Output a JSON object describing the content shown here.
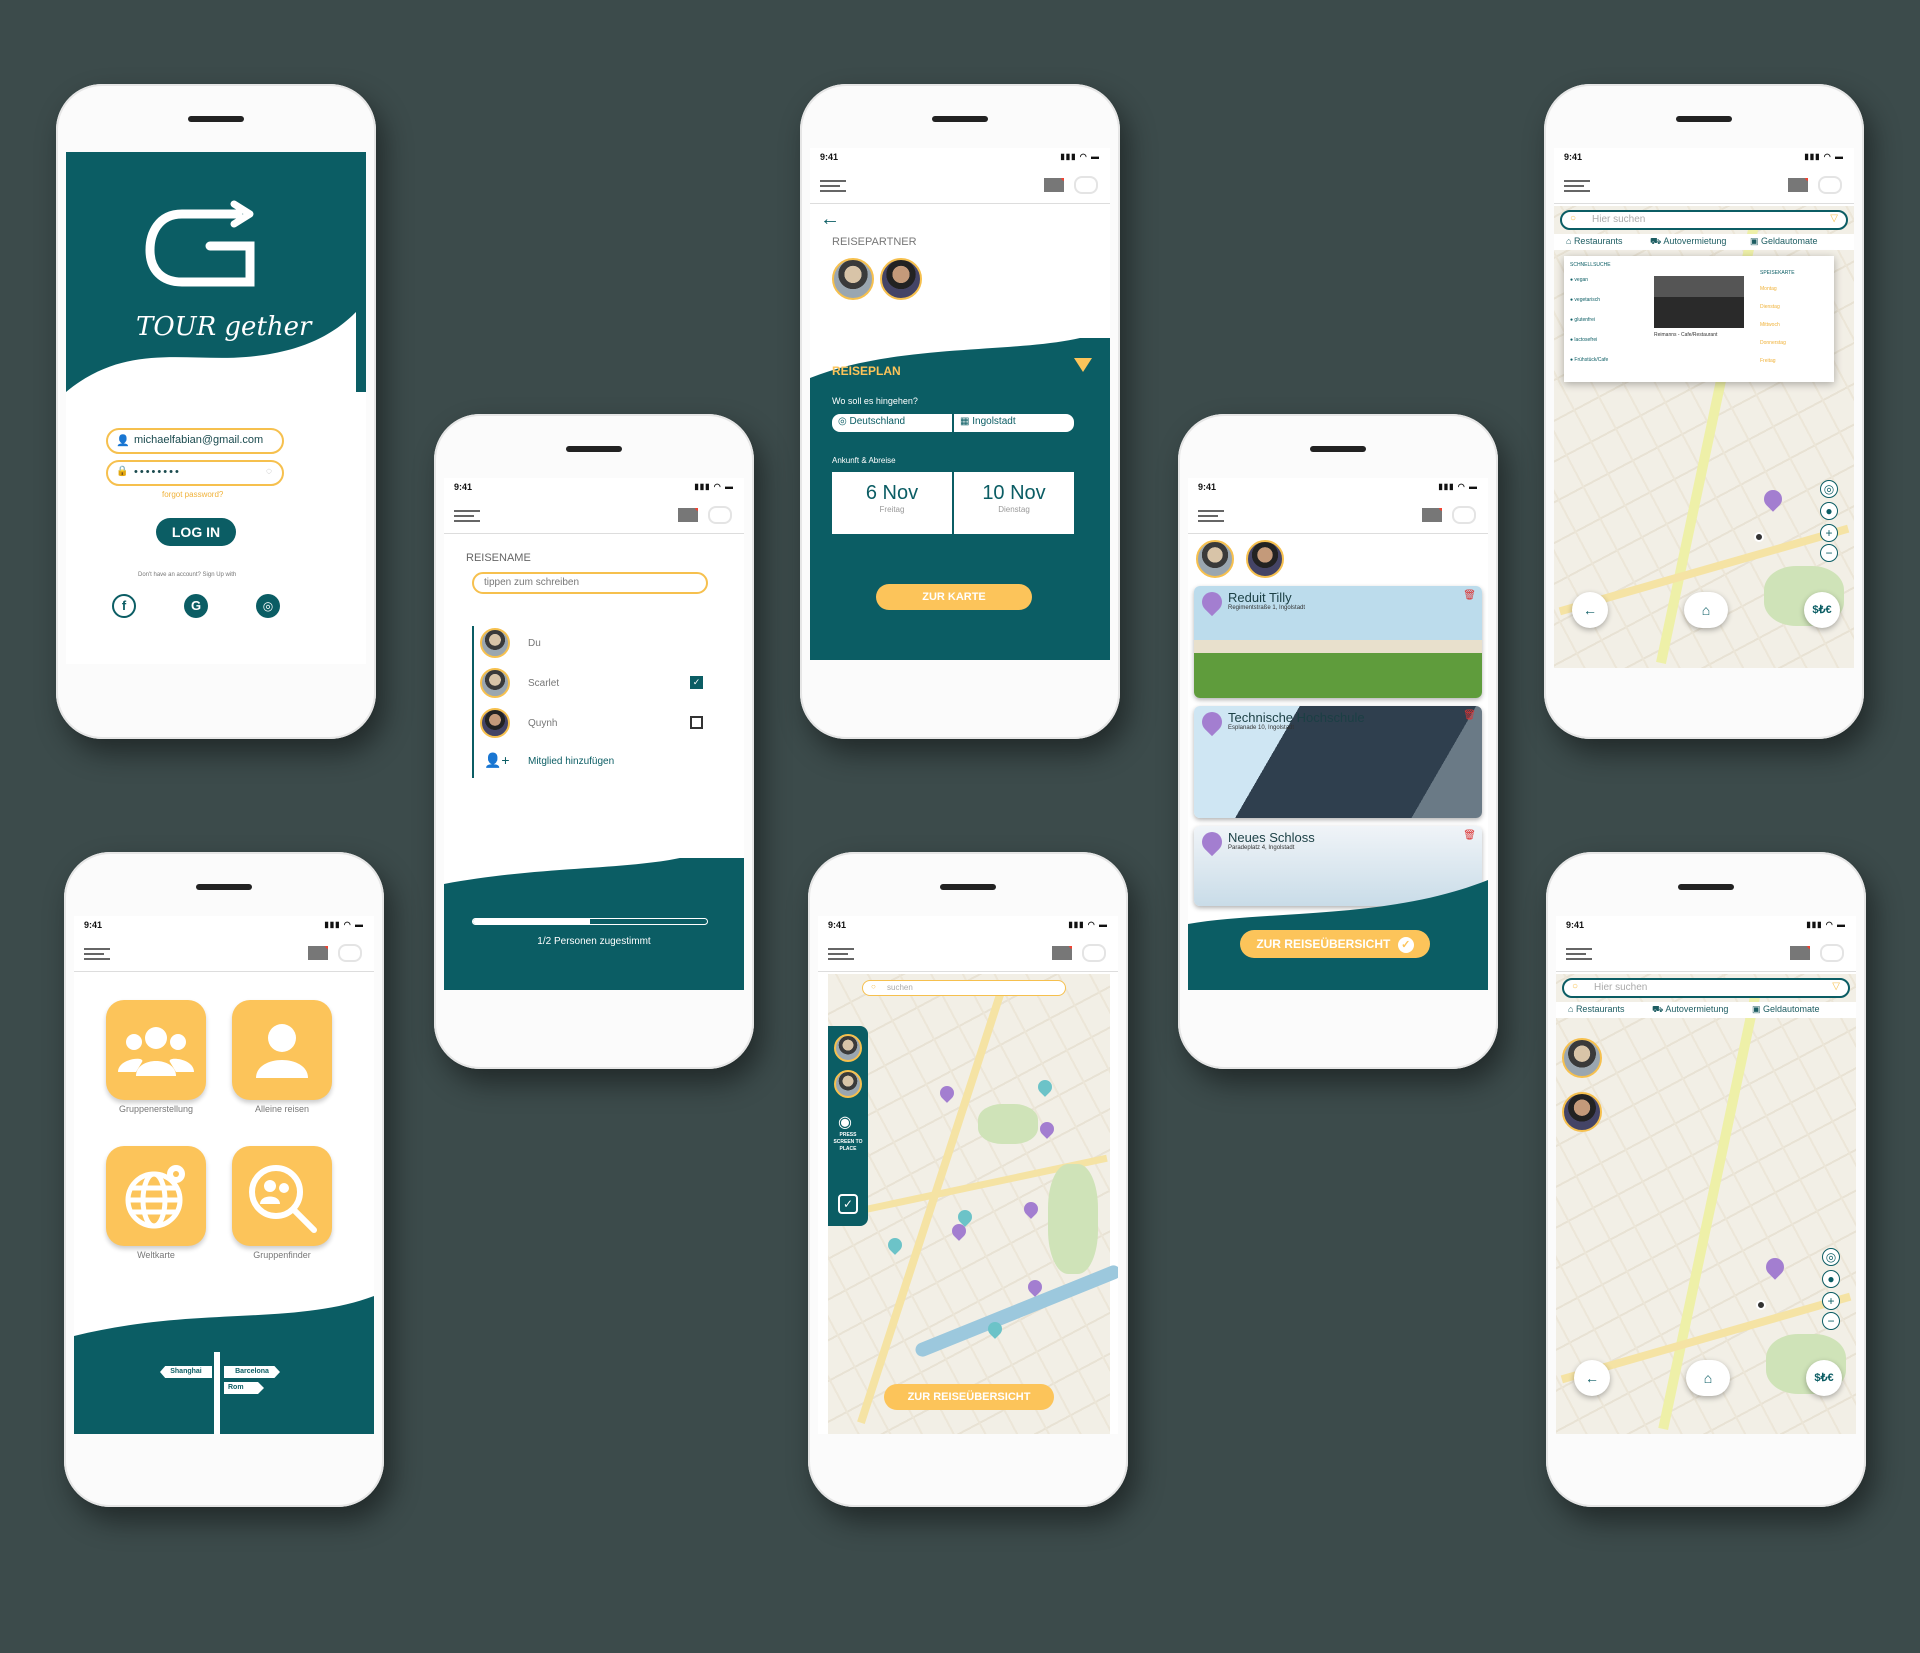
{
  "status": {
    "time": "9:41"
  },
  "login": {
    "logo_letter": "G",
    "logo_text": "TOUR gether",
    "email": "michaelfabian@gmail.com",
    "password_mask": "••••••••",
    "forgot": "forgot password?",
    "login_button": "LOG IN",
    "signup": "Don't have an account? Sign Up with"
  },
  "home": {
    "tiles": [
      "Gruppenerstellung",
      "Alleine reisen",
      "Weltkarte",
      "Gruppenfinder"
    ],
    "signs": [
      "Shanghai",
      "Barcelona",
      "Rom"
    ]
  },
  "reisename": {
    "heading": "REISENAME",
    "placeholder": "tippen zum schreiben",
    "members": [
      "Du",
      "Scarlet",
      "Quynh"
    ],
    "add_member": "Mitglied hinzufügen",
    "progress_text": "1/2 Personen zugestimmt",
    "progress_fraction": 0.5
  },
  "reiseplan": {
    "partner_heading": "REISEPARTNER",
    "plan_heading": "REISEPLAN",
    "question": "Wo soll es hingehen?",
    "country": "Deutschland",
    "city": "Ingolstadt",
    "dates_heading": "Ankunft & Abreise",
    "arrival_date": "6 Nov",
    "arrival_day": "Freitag",
    "departure_date": "10 Nov",
    "departure_day": "Dienstag",
    "button": "ZUR KARTE"
  },
  "mapscreen": {
    "search_placeholder": "suchen",
    "press_label": "PRESS SCREEN TO PLACE",
    "button": "ZUR REISEÜBERSICHT"
  },
  "overview": {
    "places": [
      {
        "name": "Reduit Tilly",
        "address": "Regimentstraße 1, Ingolstadt"
      },
      {
        "name": "Technische Hochschule",
        "address": "Esplanade 10, Ingolstadt"
      },
      {
        "name": "Neues Schloss",
        "address": "Paradeplatz 4, Ingolstadt"
      }
    ],
    "button": "ZUR REISEÜBERSICHT"
  },
  "search_map": {
    "search_placeholder": "Hier suchen",
    "categories": [
      "Restaurants",
      "Autovermietung",
      "Geldautomate"
    ],
    "schnellsuche_heading": "SCHNELLSUCHE",
    "filters": [
      "vegan",
      "vegetarisch",
      "glutenfrei",
      "lactosefrei",
      "Frühstück/Cafe"
    ],
    "place_name": "Reimanns - Cafe/Restaurant",
    "speisekarte": "SPEISEKARTE",
    "days": [
      "Montag",
      "Dienstag",
      "Mittwoch",
      "Donnerstag",
      "Freitag"
    ],
    "money_label": "$₺€"
  }
}
